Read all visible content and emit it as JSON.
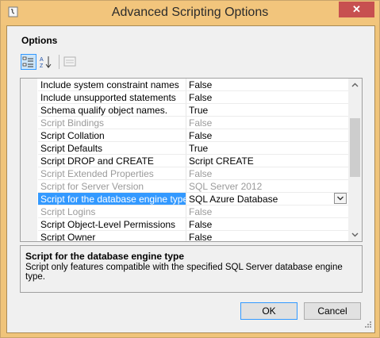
{
  "window": {
    "title": "Advanced Scripting Options",
    "close_glyph": "✕"
  },
  "options_label": "Options",
  "toolbar": {
    "buttons": [
      {
        "icon": "categorized-icon"
      },
      {
        "icon": "alphabetical-sort-icon"
      },
      {
        "icon": "property-pages-icon"
      }
    ]
  },
  "grid": {
    "rows": [
      {
        "name": "Include system constraint names",
        "value": "False",
        "disabled": false
      },
      {
        "name": "Include unsupported statements",
        "value": "False",
        "disabled": false
      },
      {
        "name": "Schema qualify object names.",
        "value": "True",
        "disabled": false
      },
      {
        "name": "Script Bindings",
        "value": "False",
        "disabled": true
      },
      {
        "name": "Script Collation",
        "value": "False",
        "disabled": false
      },
      {
        "name": "Script Defaults",
        "value": "True",
        "disabled": false
      },
      {
        "name": "Script DROP and CREATE",
        "value": "Script CREATE",
        "disabled": false
      },
      {
        "name": "Script Extended Properties",
        "value": "False",
        "disabled": true
      },
      {
        "name": "Script for Server Version",
        "value": "SQL Server 2012",
        "disabled": true
      },
      {
        "name": "Script for the database engine type",
        "value": "SQL Azure Database",
        "disabled": false,
        "selected": true
      },
      {
        "name": "Script Logins",
        "value": "False",
        "disabled": true
      },
      {
        "name": "Script Object-Level Permissions",
        "value": "False",
        "disabled": false
      },
      {
        "name": "Script Owner",
        "value": "False",
        "disabled": false
      }
    ]
  },
  "description": {
    "title": "Script for the database engine type",
    "text": "Script only features compatible with the specified SQL Server database engine type."
  },
  "buttons": {
    "ok": "OK",
    "cancel": "Cancel"
  },
  "colors": {
    "selection": "#3399ff",
    "titlebar": "#f2c57c",
    "close": "#c75050"
  }
}
